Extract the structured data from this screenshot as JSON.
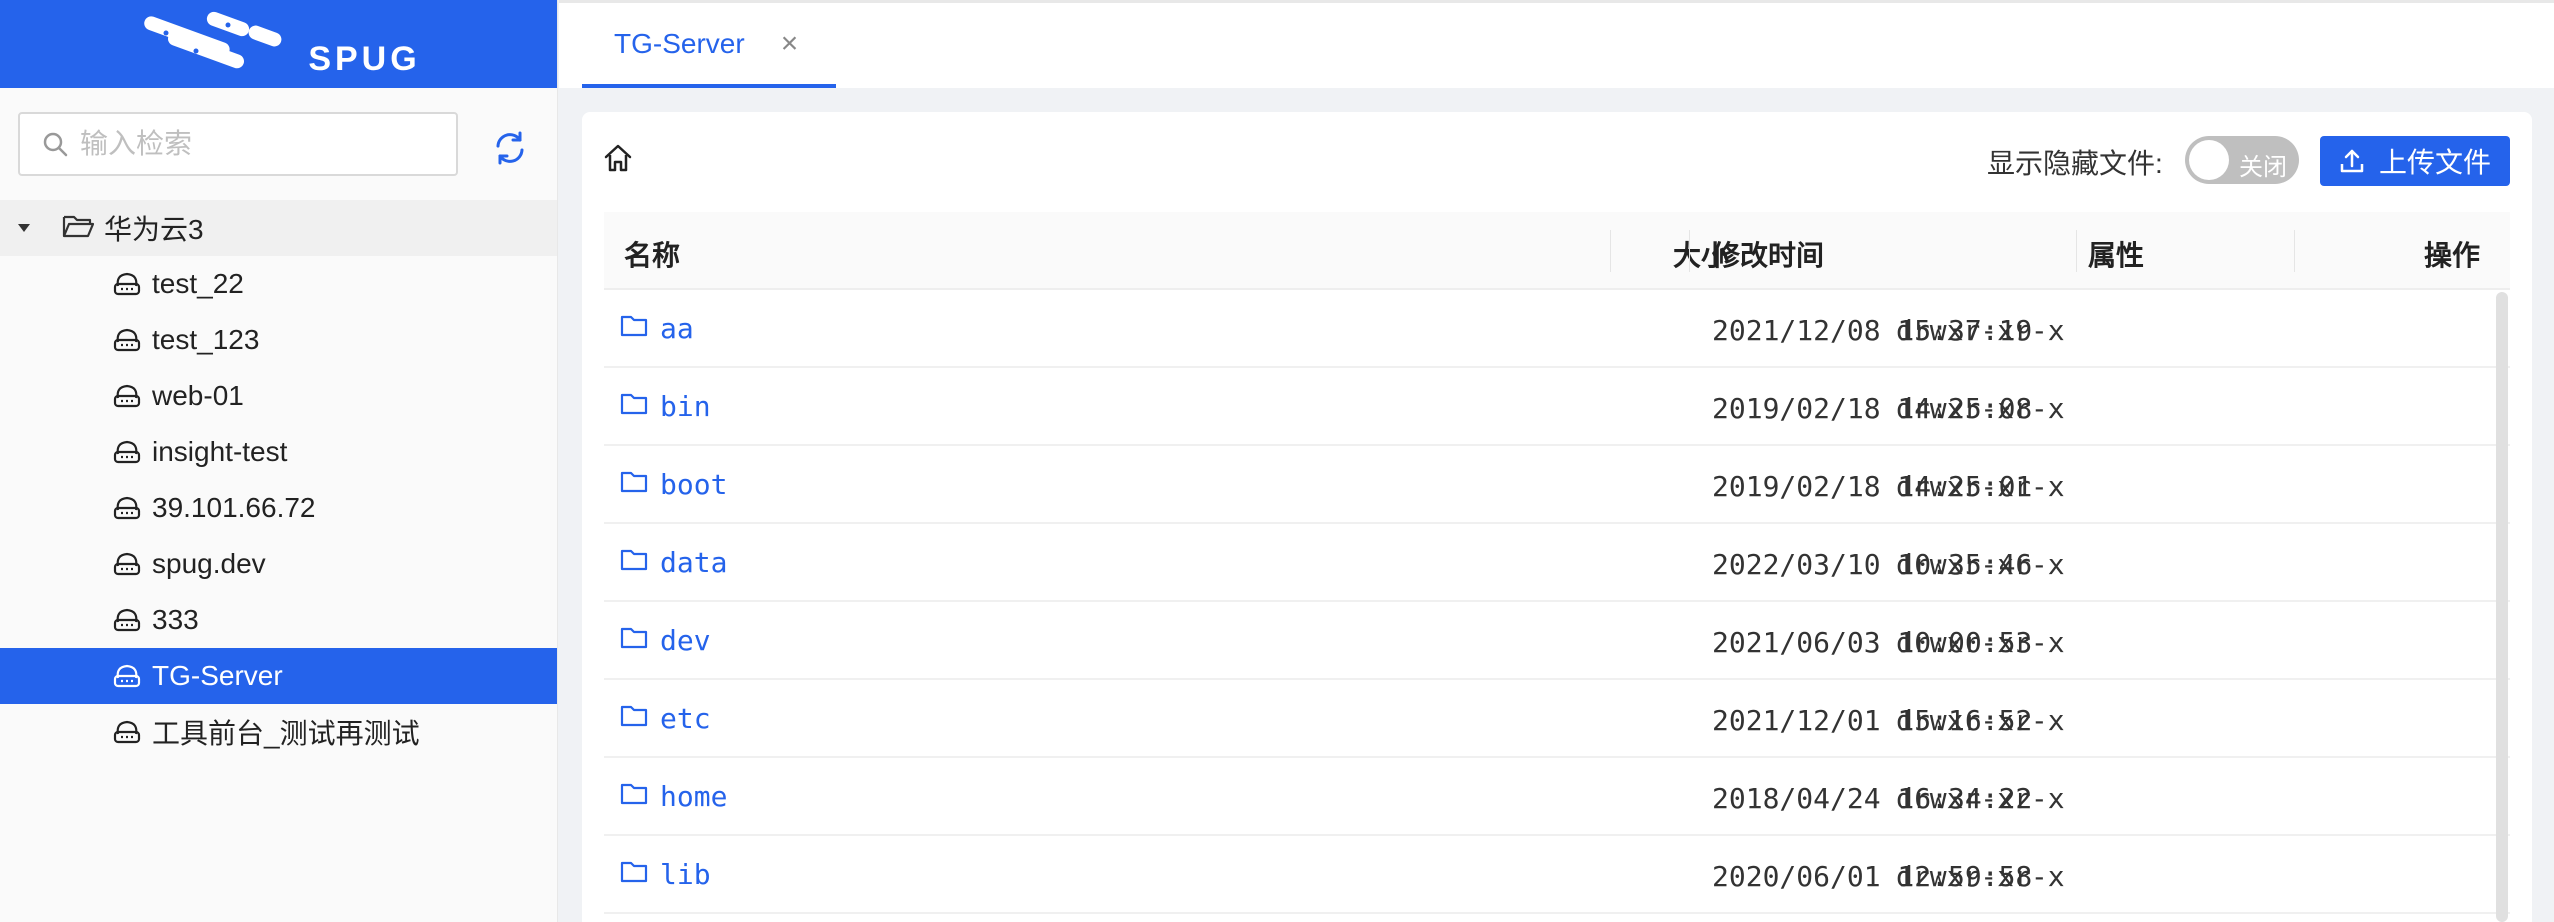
{
  "sidebar": {
    "brand": "SPUG",
    "search_placeholder": "输入检索",
    "group": {
      "label": "华为云3",
      "items": [
        {
          "label": "test_22"
        },
        {
          "label": "test_123"
        },
        {
          "label": "web-01"
        },
        {
          "label": "insight-test"
        },
        {
          "label": "39.101.66.72"
        },
        {
          "label": "spug.dev"
        },
        {
          "label": "333"
        },
        {
          "label": "TG-Server",
          "active": true
        },
        {
          "label": "工具前台_测试再测试"
        }
      ]
    }
  },
  "tabs": [
    {
      "label": "TG-Server",
      "close": "×"
    }
  ],
  "toolbar": {
    "hidden_files_label": "显示隐藏文件:",
    "toggle_text": "关闭",
    "upload_label": "上传文件"
  },
  "table": {
    "columns": [
      "名称",
      "大小",
      "修改时间",
      "属性",
      "操作"
    ],
    "rows": [
      {
        "name": "aa",
        "size": "",
        "mtime": "2021/12/08 15:37:19",
        "attr": "drwxr-xr-x"
      },
      {
        "name": "bin",
        "size": "",
        "mtime": "2019/02/18 14:25:08",
        "attr": "drwxr-xr-x"
      },
      {
        "name": "boot",
        "size": "",
        "mtime": "2019/02/18 14:25:01",
        "attr": "drwxr-xr-x"
      },
      {
        "name": "data",
        "size": "",
        "mtime": "2022/03/10 10:35:46",
        "attr": "drwxr-xr-x"
      },
      {
        "name": "dev",
        "size": "",
        "mtime": "2021/06/03 10:00:53",
        "attr": "drwxr-xr-x"
      },
      {
        "name": "etc",
        "size": "",
        "mtime": "2021/12/01 15:16:52",
        "attr": "drwxr-xr-x"
      },
      {
        "name": "home",
        "size": "",
        "mtime": "2018/04/24 16:34:22",
        "attr": "drwxr-xr-x"
      },
      {
        "name": "lib",
        "size": "",
        "mtime": "2020/06/01 12:59:58",
        "attr": "drwxr-xr-x"
      }
    ]
  },
  "colors": {
    "primary": "#2563eb",
    "sidebar_bg": "#fafafa",
    "switch_off": "#bfbfbf"
  }
}
